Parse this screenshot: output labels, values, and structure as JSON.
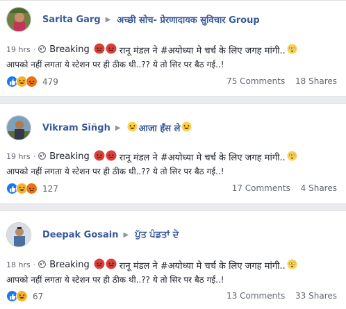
{
  "posts": [
    {
      "author": "Sarita Garg",
      "group": "अच्छी सोच- प्रेरणादायक सुविचार Group",
      "time": "19 hrs",
      "text_line1_pre": "Breaking",
      "text_line1_post": "रानू मंडल ने #अयोध्या मे चर्च के लिए जगह मांगी..",
      "text_line2": "आपको नहीं लगता ये स्टेशन पर ही ठीक थी..?? ये तो सिर पर बैठ गई..!",
      "reaction_count": "479",
      "comments": "75 Comments",
      "shares": "18 Shares",
      "reactions": [
        "like",
        "haha",
        "angry"
      ]
    },
    {
      "author": "Vikram Sĭñgh",
      "group": "आजा हँस ले",
      "time": "19 hrs",
      "text_line1_pre": "Breaking",
      "text_line1_post": "रानू मंडल ने #अयोध्या मे चर्च के लिए जगह मांगी..",
      "text_line2": "आपको नहीं लगता ये स्टेशन पर ही ठीक थी..?? ये तो सिर पर बैठ गई..!",
      "reaction_count": "127",
      "comments": "17 Comments",
      "shares": "4 Shares",
      "reactions": [
        "like",
        "haha",
        "angry"
      ]
    },
    {
      "author": "Deepak Gosain",
      "group": "ਪੁੱਤ ਪੰਡਤਾਂ ਦੇ",
      "time": "18 hrs",
      "text_line1_pre": "Breaking",
      "text_line1_post": "रानू मंडल ने #अयोध्या मे चर्च के लिए जगह मांगी..",
      "text_line2": "आपको नहीं लगता ये स्टेशन पर ही ठीक थी..?? ये तो सिर पर बैठ गई..!",
      "reaction_count": "67",
      "comments": "13 Comments",
      "shares": "33 Shares",
      "reactions": [
        "like",
        "haha"
      ]
    }
  ],
  "colors": {
    "link": "#365899",
    "meta": "#616770",
    "like": "#1877f2",
    "haha": "#f7b125",
    "angry": "#e9710f",
    "background": "#e9ebee"
  }
}
